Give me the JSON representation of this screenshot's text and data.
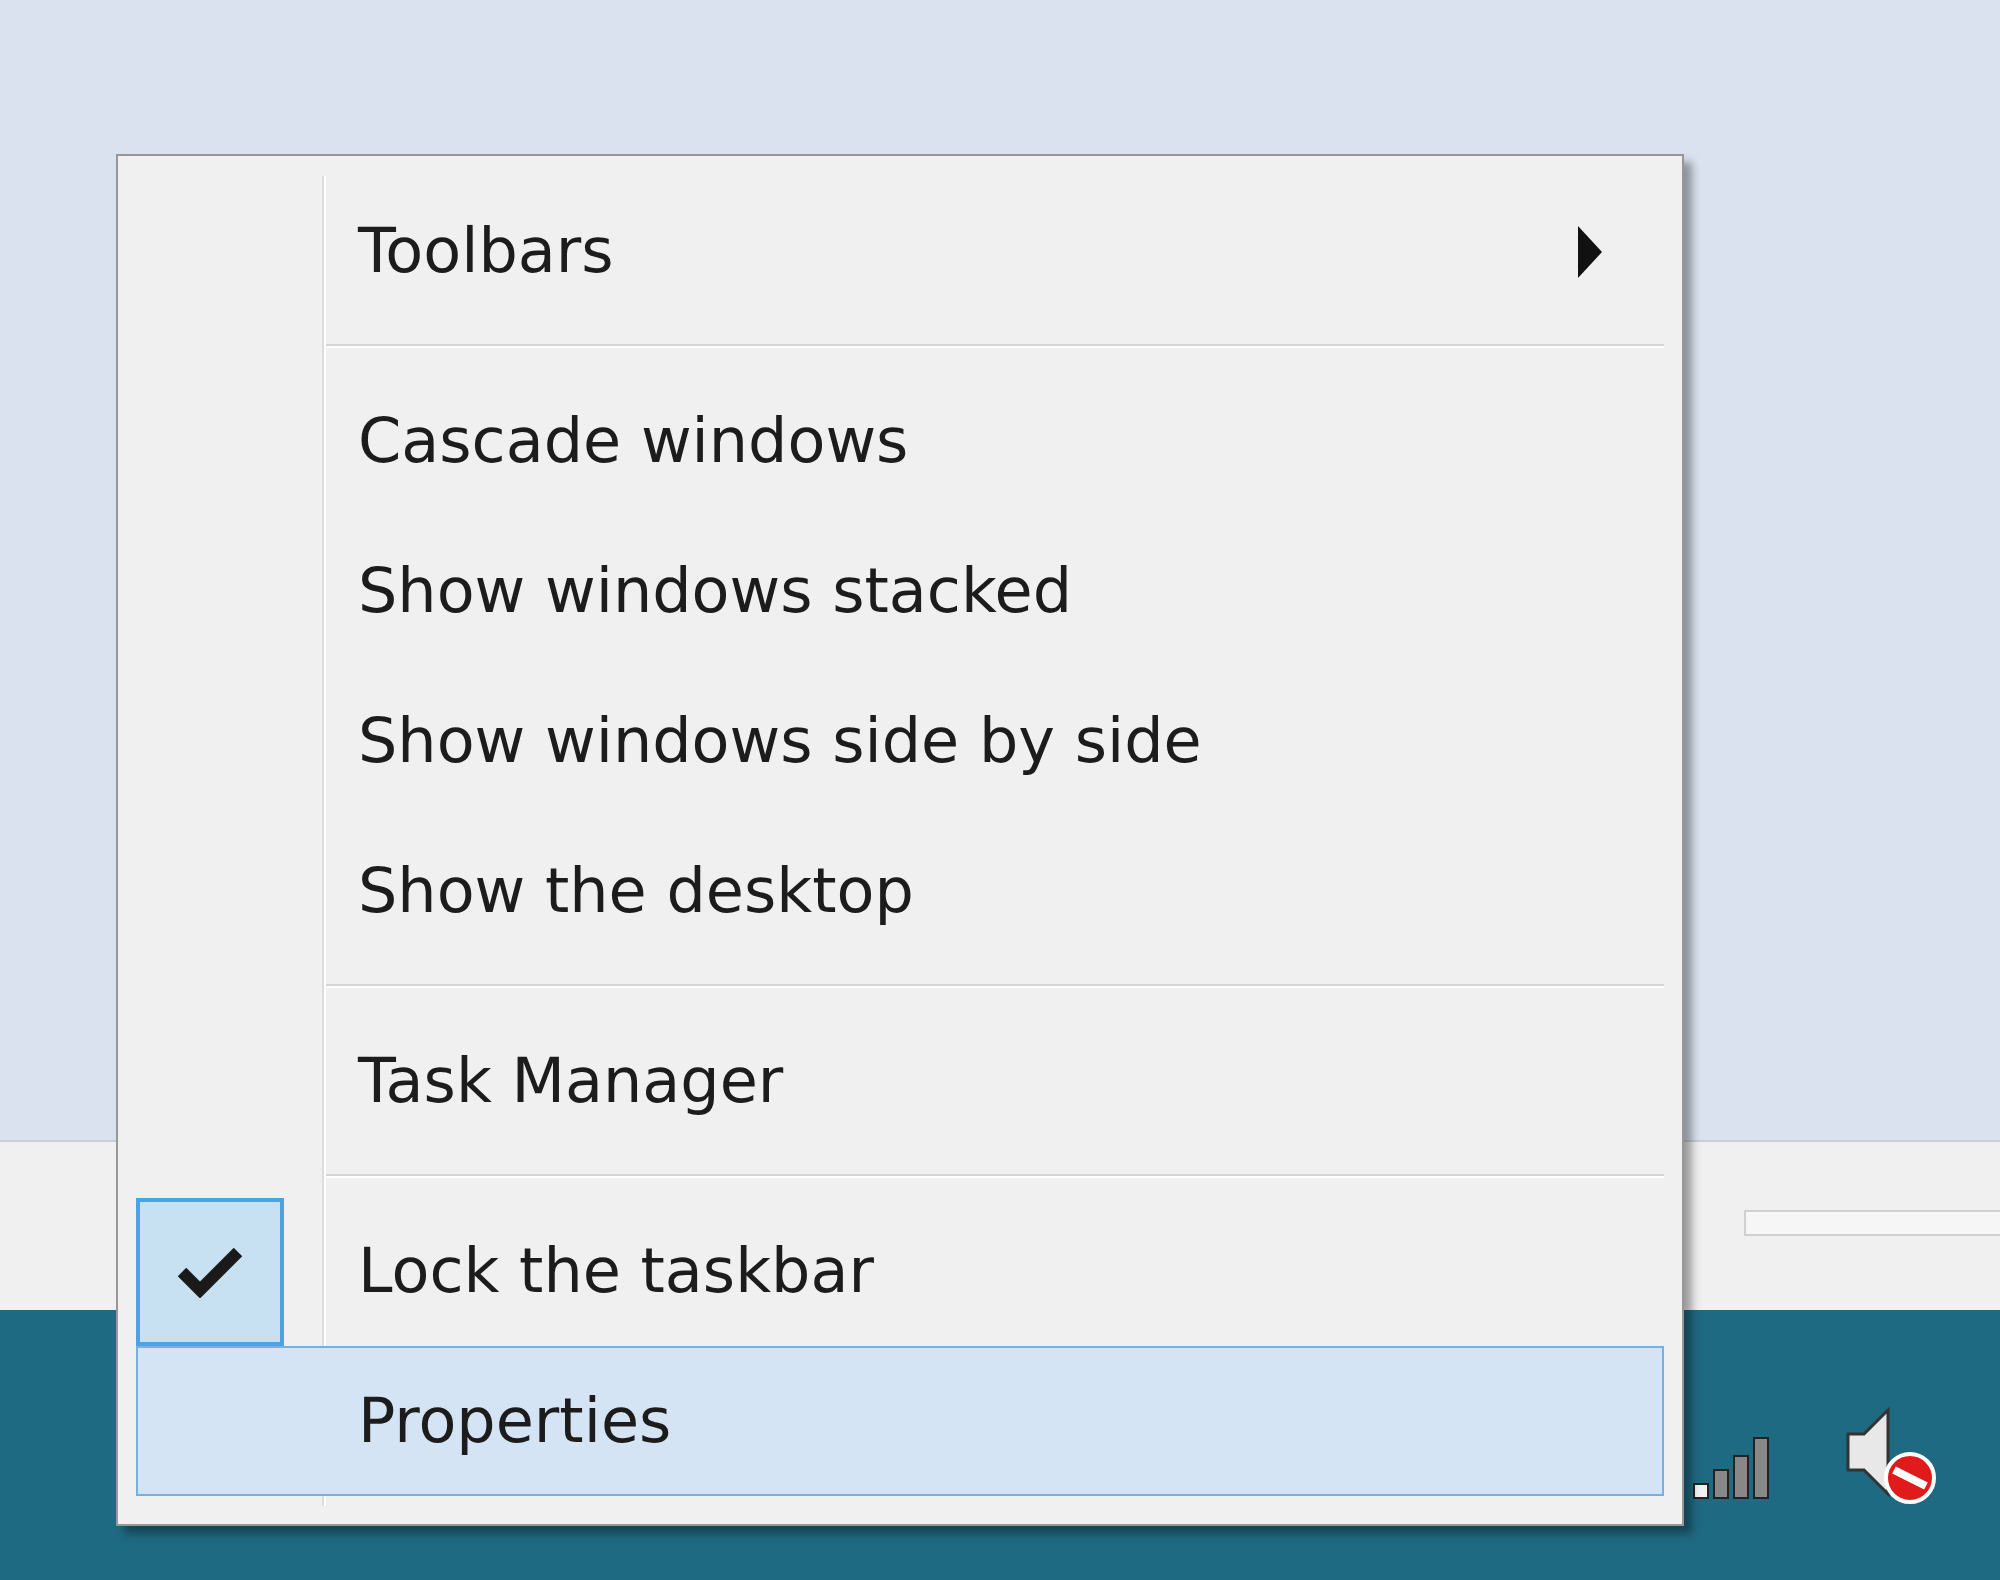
{
  "context_menu": {
    "items": [
      {
        "kind": "item",
        "label": "Toolbars",
        "submenu": true,
        "checked": false,
        "selected": false
      },
      {
        "kind": "separator"
      },
      {
        "kind": "item",
        "label": "Cascade windows",
        "submenu": false,
        "checked": false,
        "selected": false
      },
      {
        "kind": "item",
        "label": "Show windows stacked",
        "submenu": false,
        "checked": false,
        "selected": false
      },
      {
        "kind": "item",
        "label": "Show windows side by side",
        "submenu": false,
        "checked": false,
        "selected": false
      },
      {
        "kind": "item",
        "label": "Show the desktop",
        "submenu": false,
        "checked": false,
        "selected": false
      },
      {
        "kind": "separator"
      },
      {
        "kind": "item",
        "label": "Task Manager",
        "submenu": false,
        "checked": false,
        "selected": false
      },
      {
        "kind": "separator"
      },
      {
        "kind": "item",
        "label": "Lock the taskbar",
        "submenu": false,
        "checked": true,
        "selected": false
      },
      {
        "kind": "item",
        "label": "Properties",
        "submenu": false,
        "checked": false,
        "selected": true
      }
    ]
  }
}
